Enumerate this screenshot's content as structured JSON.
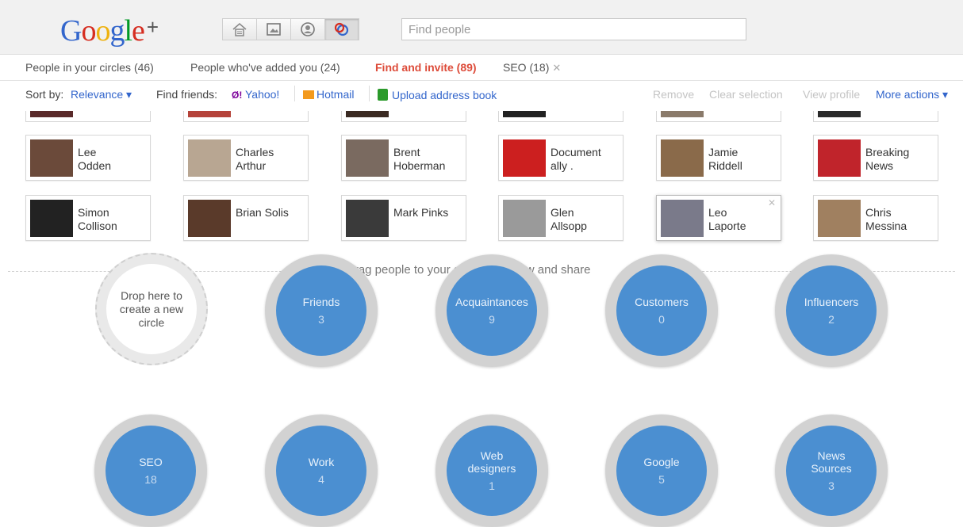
{
  "header": {
    "logo": "Google",
    "logo_plus": "+",
    "search_placeholder": "Find people",
    "nav_icons": [
      "home-icon",
      "photos-icon",
      "profile-icon",
      "circles-icon"
    ]
  },
  "tabs": [
    {
      "label": "People in your circles (46)"
    },
    {
      "label": "People who've added you (24)"
    },
    {
      "label": "Find and invite (89)"
    },
    {
      "label": "SEO (18)"
    }
  ],
  "toolbar": {
    "sort_label": "Sort by:",
    "sort_value": "Relevance ▾",
    "find_friends_label": "Find friends:",
    "yahoo": "Yahoo!",
    "hotmail": "Hotmail",
    "upload": "Upload address book",
    "remove": "Remove",
    "clear_selection": "Clear selection",
    "view_profile": "View profile",
    "more_actions": "More actions ▾"
  },
  "people_row1": [
    {
      "name": "Lee\nOdden",
      "color": "#6b4a3a"
    },
    {
      "name": "Charles\nArthur",
      "color": "#b8a692"
    },
    {
      "name": "Brent\nHoberman",
      "color": "#7a6a60"
    },
    {
      "name": "Document\nally .",
      "color": "#cc1f1f"
    },
    {
      "name": "Jamie\nRiddell",
      "color": "#8a6a4a"
    },
    {
      "name": "Breaking\nNews",
      "color": "#c0242b"
    }
  ],
  "people_row2": [
    {
      "name": "Simon\nCollison",
      "color": "#222222"
    },
    {
      "name": "Brian Solis",
      "color": "#5a3a2a"
    },
    {
      "name": "Mark Pinks",
      "color": "#3a3a3a"
    },
    {
      "name": "Glen\nAllsopp",
      "color": "#9a9a9a"
    },
    {
      "name": "Leo\nLaporte",
      "color": "#7a7a8a"
    },
    {
      "name": "Chris\nMessina",
      "color": "#a08060"
    }
  ],
  "drop_message": "Drag people to your circles to follow and share",
  "new_circle": "Drop here to\ncreate a new\ncircle",
  "circles_row1": [
    {
      "name": "Friends",
      "count": "3"
    },
    {
      "name": "Acquaintances",
      "count": "9"
    },
    {
      "name": "Customers",
      "count": "0"
    },
    {
      "name": "Influencers",
      "count": "2"
    }
  ],
  "circles_row2": [
    {
      "name": "SEO",
      "count": "18"
    },
    {
      "name": "Work",
      "count": "4"
    },
    {
      "name": "Web\ndesigners",
      "count": "1"
    },
    {
      "name": "Google",
      "count": "5"
    },
    {
      "name": "News\nSources",
      "count": "3"
    }
  ]
}
